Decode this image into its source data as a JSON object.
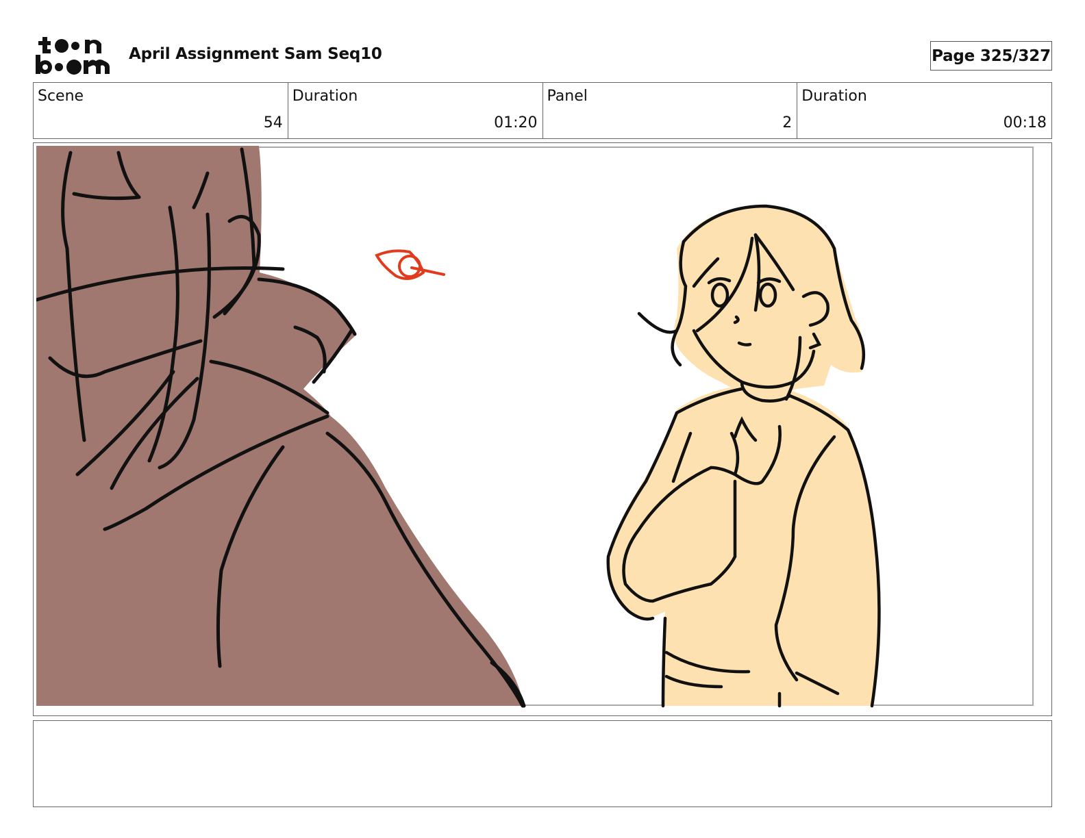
{
  "header": {
    "logo_text": "toon boom",
    "title": "April Assignment Sam Seq10",
    "page_label": "Page 325/327"
  },
  "info": {
    "scene_label": "Scene",
    "scene_value": "54",
    "scene_duration_label": "Duration",
    "scene_duration_value": "01:20",
    "panel_label": "Panel",
    "panel_value": "2",
    "panel_duration_label": "Duration",
    "panel_duration_value": "00:18"
  },
  "colors": {
    "coat_fill": "#a07870",
    "skin_fill": "#fde1b0",
    "ink": "#111111",
    "annotation": "#e23a1c"
  },
  "notes": {
    "text": ""
  }
}
